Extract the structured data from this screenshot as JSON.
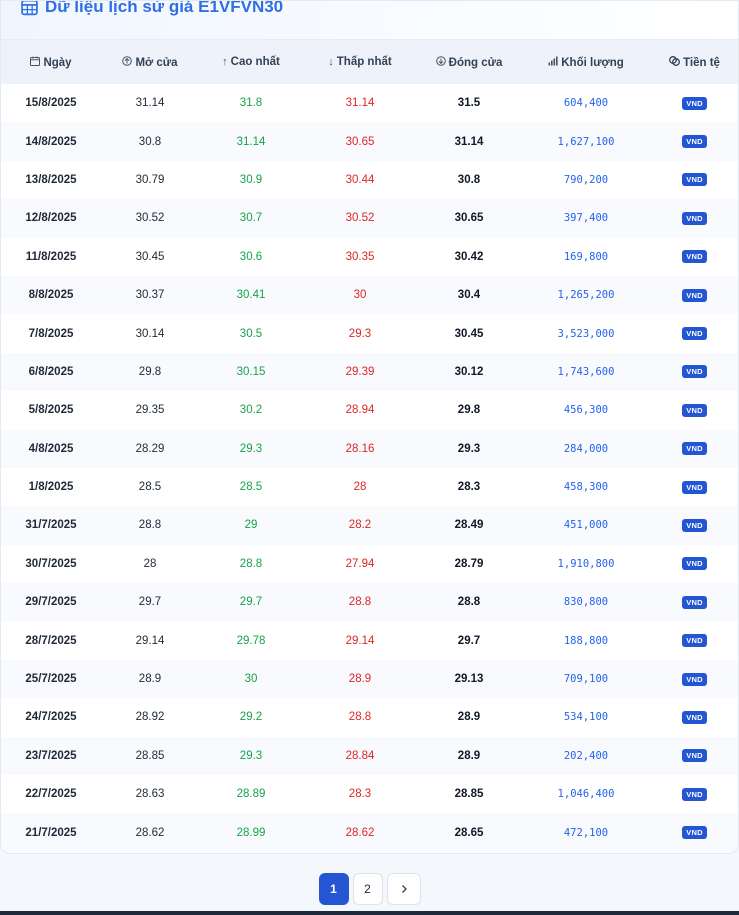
{
  "title": "Dữ liệu lịch sử giá E1VFVN30",
  "columns": [
    {
      "key": "date",
      "label": "Ngày",
      "icon": "calendar-icon"
    },
    {
      "key": "open",
      "label": "Mở cửa",
      "icon": "arrow-up-circle-icon"
    },
    {
      "key": "high",
      "label": "Cao nhất",
      "icon": "arrow-up-icon"
    },
    {
      "key": "low",
      "label": "Thấp nhất",
      "icon": "arrow-down-icon"
    },
    {
      "key": "close",
      "label": "Đóng cửa",
      "icon": "arrow-down-circle-icon"
    },
    {
      "key": "volume",
      "label": "Khối lượng",
      "icon": "bar-chart-icon"
    },
    {
      "key": "currency",
      "label": "Tiền tệ",
      "icon": "coins-icon"
    }
  ],
  "rows": [
    {
      "date": "15/8/2025",
      "open": "31.14",
      "high": "31.8",
      "low": "31.14",
      "close": "31.5",
      "volume": "604,400",
      "currency": "VND"
    },
    {
      "date": "14/8/2025",
      "open": "30.8",
      "high": "31.14",
      "low": "30.65",
      "close": "31.14",
      "volume": "1,627,100",
      "currency": "VND"
    },
    {
      "date": "13/8/2025",
      "open": "30.79",
      "high": "30.9",
      "low": "30.44",
      "close": "30.8",
      "volume": "790,200",
      "currency": "VND"
    },
    {
      "date": "12/8/2025",
      "open": "30.52",
      "high": "30.7",
      "low": "30.52",
      "close": "30.65",
      "volume": "397,400",
      "currency": "VND"
    },
    {
      "date": "11/8/2025",
      "open": "30.45",
      "high": "30.6",
      "low": "30.35",
      "close": "30.42",
      "volume": "169,800",
      "currency": "VND"
    },
    {
      "date": "8/8/2025",
      "open": "30.37",
      "high": "30.41",
      "low": "30",
      "close": "30.4",
      "volume": "1,265,200",
      "currency": "VND"
    },
    {
      "date": "7/8/2025",
      "open": "30.14",
      "high": "30.5",
      "low": "29.3",
      "close": "30.45",
      "volume": "3,523,000",
      "currency": "VND"
    },
    {
      "date": "6/8/2025",
      "open": "29.8",
      "high": "30.15",
      "low": "29.39",
      "close": "30.12",
      "volume": "1,743,600",
      "currency": "VND"
    },
    {
      "date": "5/8/2025",
      "open": "29.35",
      "high": "30.2",
      "low": "28.94",
      "close": "29.8",
      "volume": "456,300",
      "currency": "VND"
    },
    {
      "date": "4/8/2025",
      "open": "28.29",
      "high": "29.3",
      "low": "28.16",
      "close": "29.3",
      "volume": "284,000",
      "currency": "VND"
    },
    {
      "date": "1/8/2025",
      "open": "28.5",
      "high": "28.5",
      "low": "28",
      "close": "28.3",
      "volume": "458,300",
      "currency": "VND"
    },
    {
      "date": "31/7/2025",
      "open": "28.8",
      "high": "29",
      "low": "28.2",
      "close": "28.49",
      "volume": "451,000",
      "currency": "VND"
    },
    {
      "date": "30/7/2025",
      "open": "28",
      "high": "28.8",
      "low": "27.94",
      "close": "28.79",
      "volume": "1,910,800",
      "currency": "VND"
    },
    {
      "date": "29/7/2025",
      "open": "29.7",
      "high": "29.7",
      "low": "28.8",
      "close": "28.8",
      "volume": "830,800",
      "currency": "VND"
    },
    {
      "date": "28/7/2025",
      "open": "29.14",
      "high": "29.78",
      "low": "29.14",
      "close": "29.7",
      "volume": "188,800",
      "currency": "VND"
    },
    {
      "date": "25/7/2025",
      "open": "28.9",
      "high": "30",
      "low": "28.9",
      "close": "29.13",
      "volume": "709,100",
      "currency": "VND"
    },
    {
      "date": "24/7/2025",
      "open": "28.92",
      "high": "29.2",
      "low": "28.8",
      "close": "28.9",
      "volume": "534,100",
      "currency": "VND"
    },
    {
      "date": "23/7/2025",
      "open": "28.85",
      "high": "29.3",
      "low": "28.84",
      "close": "28.9",
      "volume": "202,400",
      "currency": "VND"
    },
    {
      "date": "22/7/2025",
      "open": "28.63",
      "high": "28.89",
      "low": "28.3",
      "close": "28.85",
      "volume": "1,046,400",
      "currency": "VND"
    },
    {
      "date": "21/7/2025",
      "open": "28.62",
      "high": "28.99",
      "low": "28.62",
      "close": "28.65",
      "volume": "472,100",
      "currency": "VND"
    }
  ],
  "pagination": {
    "pages": [
      "1",
      "2"
    ],
    "current": "1",
    "next_icon": "chevron-right-icon"
  },
  "colors": {
    "accent": "#2f6fe3",
    "high": "#16a34a",
    "low": "#dc2626",
    "volume": "#2563eb",
    "badge": "#2456d4"
  }
}
